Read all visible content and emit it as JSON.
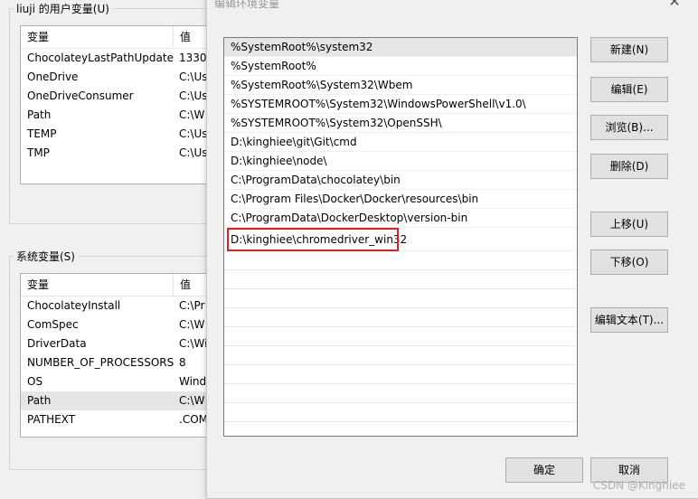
{
  "user_vars": {
    "title": "liuji 的用户变量(U)",
    "headers": {
      "name": "变量",
      "value": "值"
    },
    "rows": [
      {
        "name": "ChocolateyLastPathUpdate",
        "value": "1330…"
      },
      {
        "name": "OneDrive",
        "value": "C:\\Us"
      },
      {
        "name": "OneDriveConsumer",
        "value": "C:\\Us"
      },
      {
        "name": "Path",
        "value": "C:\\W"
      },
      {
        "name": "TEMP",
        "value": "C:\\Us"
      },
      {
        "name": "TMP",
        "value": "C:\\Us"
      }
    ]
  },
  "system_vars": {
    "title": "系统变量(S)",
    "headers": {
      "name": "变量",
      "value": "值"
    },
    "rows": [
      {
        "name": "ChocolateyInstall",
        "value": "C:\\Pr"
      },
      {
        "name": "ComSpec",
        "value": "C:\\W"
      },
      {
        "name": "DriverData",
        "value": "C:\\Wi"
      },
      {
        "name": "NUMBER_OF_PROCESSORS",
        "value": "8"
      },
      {
        "name": "OS",
        "value": "Wind"
      },
      {
        "name": "Path",
        "value": "C:\\W"
      },
      {
        "name": "PATHEXT",
        "value": ".COM"
      }
    ],
    "selected_index": 5
  },
  "dialog": {
    "title": "编辑环境变量",
    "close_glyph": "✕",
    "paths": [
      "%SystemRoot%\\system32",
      "%SystemRoot%",
      "%SystemRoot%\\System32\\Wbem",
      "%SYSTEMROOT%\\System32\\WindowsPowerShell\\v1.0\\",
      "%SYSTEMROOT%\\System32\\OpenSSH\\",
      "D:\\kinghiee\\git\\Git\\cmd",
      "D:\\kinghiee\\node\\",
      "C:\\ProgramData\\chocolatey\\bin",
      "C:\\Program Files\\Docker\\Docker\\resources\\bin",
      "C:\\ProgramData\\DockerDesktop\\version-bin",
      "D:\\kinghiee\\chromedriver_win32"
    ],
    "selected_index": 0,
    "highlighted_index": 10,
    "buttons": {
      "new": "新建(N)",
      "edit": "编辑(E)",
      "browse": "浏览(B)...",
      "delete": "删除(D)",
      "move_up": "上移(U)",
      "move_down": "下移(O)",
      "edit_text": "编辑文本(T)...",
      "ok": "确定",
      "cancel": "取消"
    },
    "highlight_color": "#e02020"
  },
  "watermark": "CSDN @Kinghiee"
}
